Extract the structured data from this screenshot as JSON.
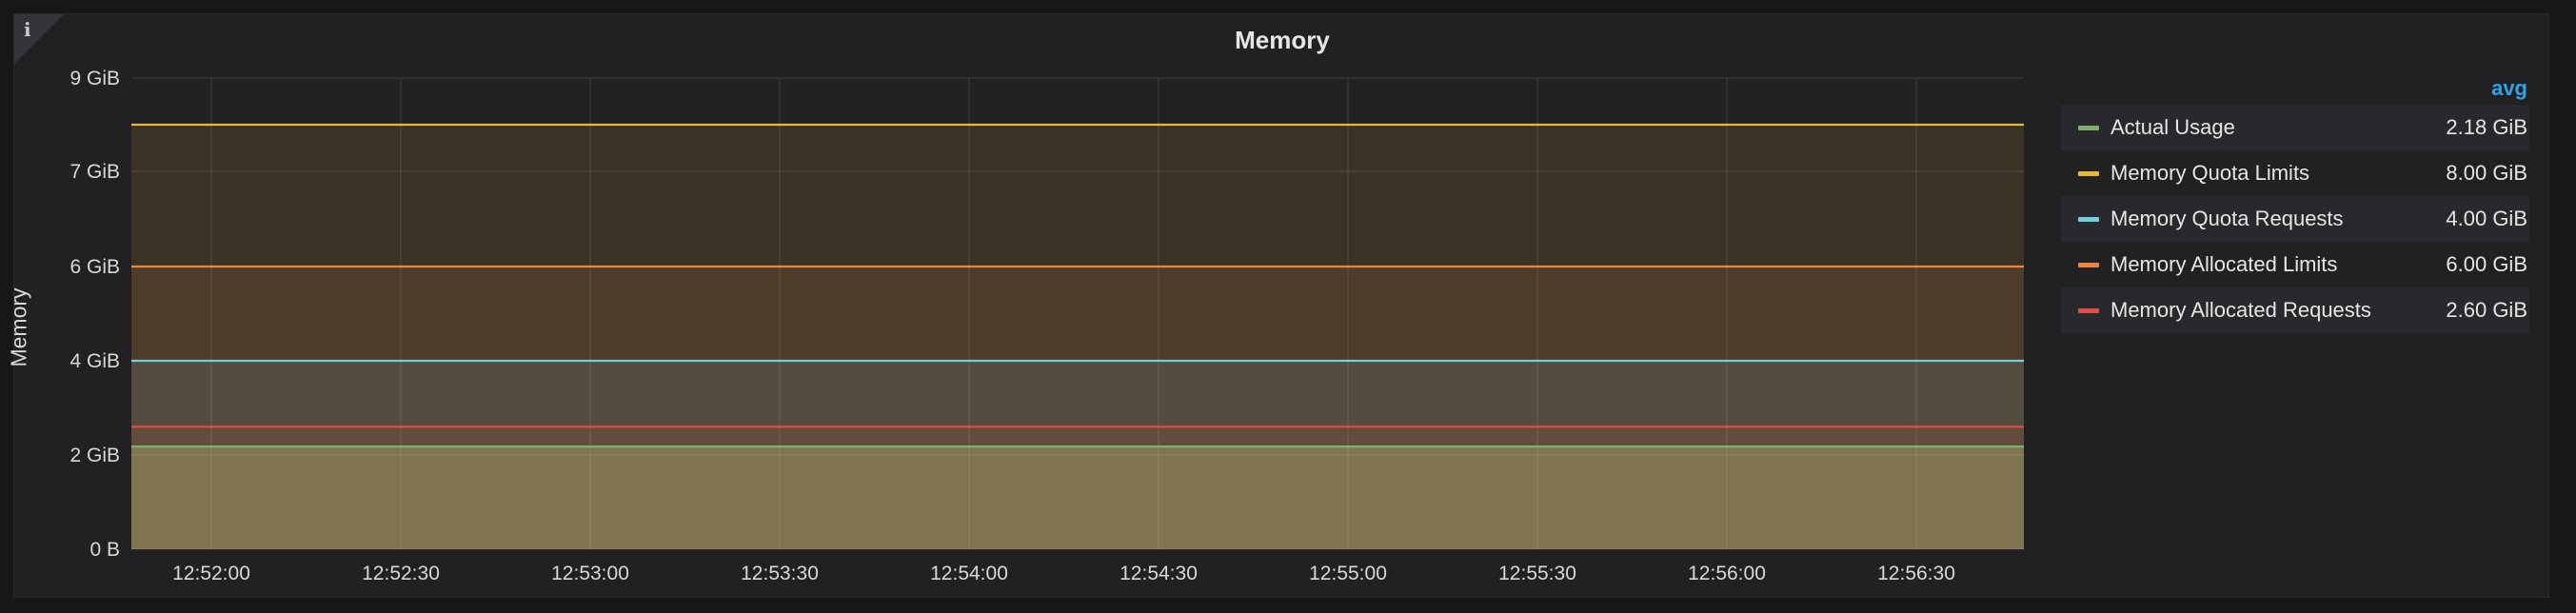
{
  "panel": {
    "title": "Memory",
    "info_icon": "i",
    "y_axis_label": "Memory"
  },
  "chart_data": {
    "type": "area",
    "title": "Memory",
    "ylabel": "Memory",
    "xlabel": "",
    "y_unit": "GiB",
    "y_ticks": [
      {
        "value": 0,
        "label": "0 B"
      },
      {
        "value": 2,
        "label": "2 GiB"
      },
      {
        "value": 4,
        "label": "4 GiB"
      },
      {
        "value": 6,
        "label": "6 GiB"
      },
      {
        "value": 7,
        "label": "7 GiB"
      },
      {
        "value": 9,
        "label": "9 GiB"
      }
    ],
    "x_ticks": [
      "12:52:00",
      "12:52:30",
      "12:53:00",
      "12:53:30",
      "12:54:00",
      "12:54:30",
      "12:55:00",
      "12:55:30",
      "12:56:00",
      "12:56:30"
    ],
    "grid": true,
    "legend_position": "right",
    "series": [
      {
        "name": "Actual Usage",
        "color": "#7eb26d",
        "values": [
          2.18,
          2.18
        ],
        "fill": true
      },
      {
        "name": "Memory Quota Limits",
        "color": "#eab839",
        "values": [
          8.0,
          8.0
        ],
        "fill": true
      },
      {
        "name": "Memory Quota Requests",
        "color": "#6ed0e0",
        "values": [
          4.0,
          4.0
        ],
        "fill": true
      },
      {
        "name": "Memory Allocated Limits",
        "color": "#ef843c",
        "values": [
          6.0,
          6.0
        ],
        "fill": true
      },
      {
        "name": "Memory Allocated Requests",
        "color": "#e24d42",
        "values": [
          2.6,
          2.6
        ],
        "fill": true
      }
    ]
  },
  "legend": {
    "header": "avg",
    "items": [
      {
        "name": "Actual Usage",
        "value": "2.18 GiB",
        "color": "#7eb26d"
      },
      {
        "name": "Memory Quota Limits",
        "value": "8.00 GiB",
        "color": "#eab839"
      },
      {
        "name": "Memory Quota Requests",
        "value": "4.00 GiB",
        "color": "#6ed0e0"
      },
      {
        "name": "Memory Allocated Limits",
        "value": "6.00 GiB",
        "color": "#ef843c"
      },
      {
        "name": "Memory Allocated Requests",
        "value": "2.60 GiB",
        "color": "#e24d42"
      }
    ]
  }
}
